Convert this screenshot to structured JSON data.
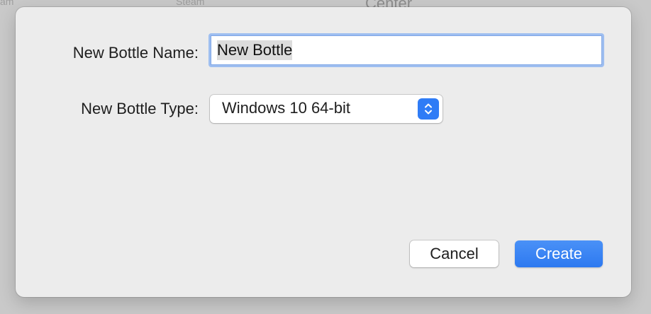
{
  "backdrop": {
    "left_text": "am",
    "middle_text": "Steam",
    "right_text": "Center"
  },
  "dialog": {
    "name_label": "New Bottle Name:",
    "name_value": "New Bottle",
    "type_label": "New Bottle Type:",
    "type_selected": "Windows 10 64-bit",
    "cancel_label": "Cancel",
    "create_label": "Create",
    "accent_color": "#2f7cf6"
  }
}
